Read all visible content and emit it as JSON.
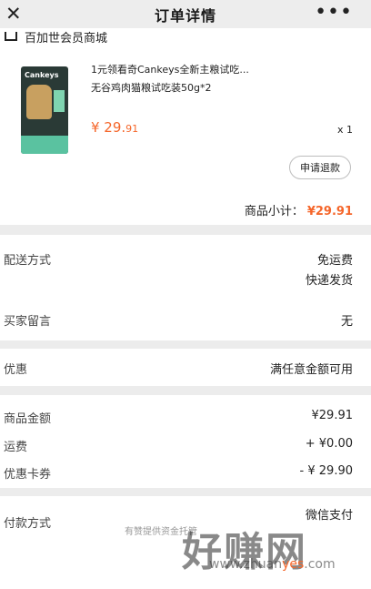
{
  "nav": {
    "title": "订单详情",
    "close_icon": "close-icon",
    "more_icon": "more-icon"
  },
  "store": {
    "name": "百加世会员商城",
    "product": {
      "name_line1": "1元领看奇Cankeys全新主粮试吃...",
      "name_line2": "无谷鸡肉猫粮试吃装50g*2",
      "price_main": "¥ 29.",
      "price_cents": "91",
      "qty": "x 1",
      "thumb_brand": "Cankeys"
    },
    "refund_button": "申请退款",
    "subtotal_label": "商品小计：",
    "subtotal_value": "¥29.91"
  },
  "delivery": {
    "label": "配送方式",
    "value1": "免运费",
    "value2": "快递发货"
  },
  "message": {
    "label": "买家留言",
    "value": "无"
  },
  "discount": {
    "label": "优惠",
    "value": "满任意金额可用"
  },
  "amounts": {
    "goods_label": "商品金额",
    "goods_value": "¥29.91",
    "shipping_label": "运费",
    "shipping_value": "+ ¥0.00",
    "coupon_label": "优惠卡券",
    "coupon_value": "- ¥ 29.90"
  },
  "payment": {
    "label": "付款方式",
    "value": "微信支付",
    "note": "有赞提供资金托管",
    "watermark": "好赚网",
    "watermark_url": "www.zhuan",
    "watermark_url2": "yes",
    "watermark_url3": ".com"
  },
  "accent_color": "#f5662a"
}
